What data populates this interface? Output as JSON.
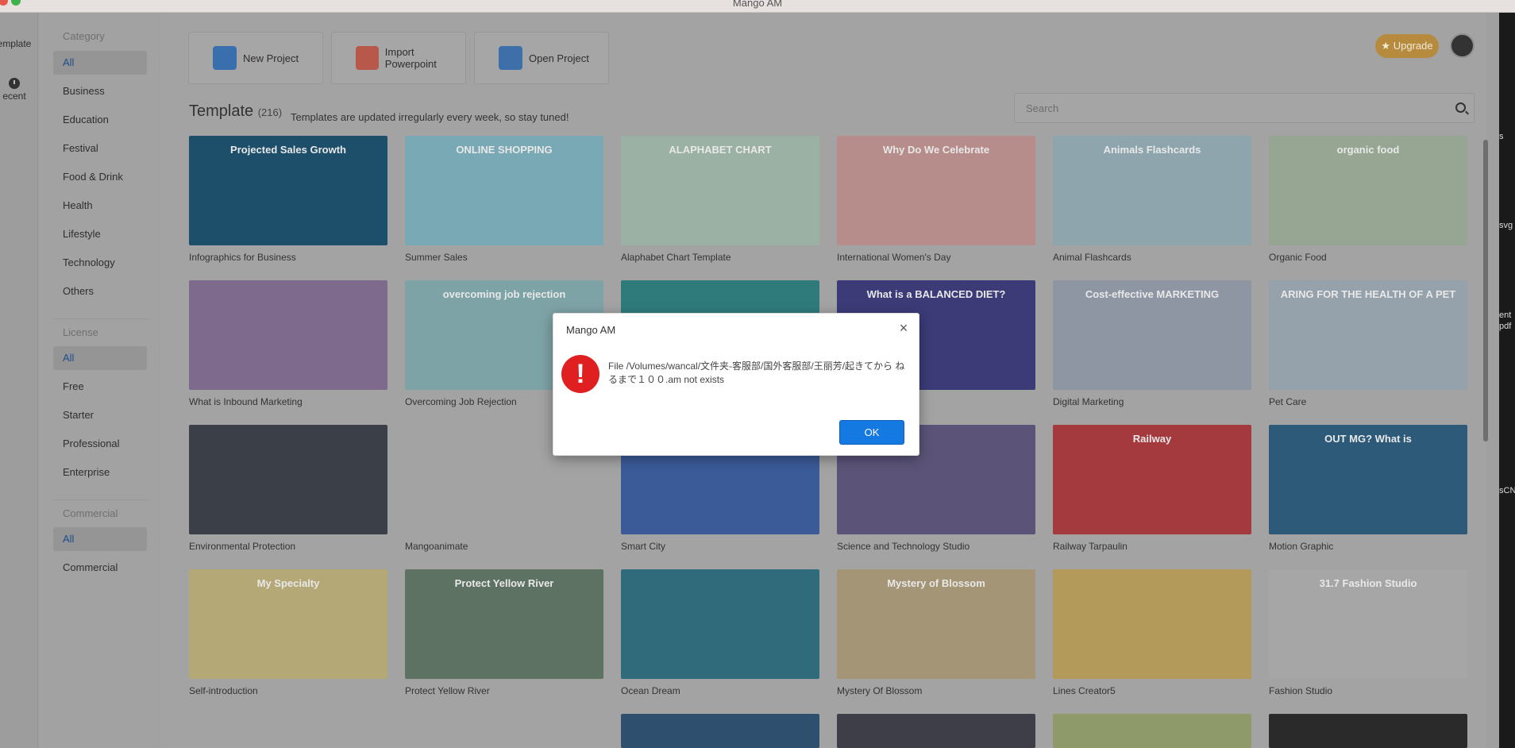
{
  "window": {
    "title": "Mango AM"
  },
  "rail": {
    "items": [
      {
        "label": "Template",
        "display": "emplate"
      },
      {
        "label": "Recent",
        "display": "ecent"
      }
    ]
  },
  "sidebar": {
    "category_heading": "Category",
    "categories": [
      "All",
      "Business",
      "Education",
      "Festival",
      "Food & Drink",
      "Health",
      "Lifestyle",
      "Technology",
      "Others"
    ],
    "license_heading": "License",
    "licenses": [
      "All",
      "Free",
      "Starter",
      "Professional",
      "Enterprise"
    ],
    "commercial_heading": "Commercial",
    "commercials": [
      "All",
      "Commercial"
    ]
  },
  "toolbar": {
    "new_project": "New Project",
    "import_ppt": "Import Powerpoint",
    "open_project": "Open Project",
    "upgrade": "Upgrade"
  },
  "section": {
    "title": "Template",
    "count": "(216)",
    "note": "Templates are updated irregularly every week, so stay tuned!"
  },
  "search": {
    "placeholder": "Search"
  },
  "templates": [
    {
      "caption": "Infographics for Business",
      "thumb_text": "Projected Sales Growth",
      "color": "#1d4e6a"
    },
    {
      "caption": "Summer Sales",
      "thumb_text": "ONLINE SHOPPING",
      "color": "#78a9b4"
    },
    {
      "caption": "Alaphabet Chart Template",
      "thumb_text": "ALAPHABET CHART",
      "color": "#9bb1a3"
    },
    {
      "caption": "International Women's Day",
      "thumb_text": "Why Do We Celebrate",
      "color": "#b78d8b"
    },
    {
      "caption": "Animal Flashcards",
      "thumb_text": "Animals Flashcards",
      "color": "#8fa5ae"
    },
    {
      "caption": "Organic Food",
      "thumb_text": "organic food",
      "color": "#97a692"
    },
    {
      "caption": "What is Inbound Marketing",
      "thumb_text": "",
      "color": "#7d6a8c"
    },
    {
      "caption": "Overcoming Job Rejection",
      "thumb_text": "overcoming job rejection",
      "color": "#7ea3a6"
    },
    {
      "caption": "",
      "thumb_text": "",
      "color": "#2f7b7b"
    },
    {
      "caption": "",
      "thumb_text": "What is a BALANCED DIET?",
      "color": "#3c3b78"
    },
    {
      "caption": "Digital Marketing",
      "thumb_text": "Cost-effective MARKETING",
      "color": "#8e96a3"
    },
    {
      "caption": "Pet Care",
      "thumb_text": "ARING FOR THE HEALTH OF A PET",
      "color": "#95a2ab"
    },
    {
      "caption": "Environmental Protection",
      "thumb_text": "",
      "color": "#3b3f47"
    },
    {
      "caption": "Mangoanimate",
      "thumb_text": "",
      "color": "#a3a3a3"
    },
    {
      "caption": "Smart City",
      "thumb_text": "How Smart City Works ?",
      "color": "#3b5b98"
    },
    {
      "caption": "Science and Technology Studio",
      "thumb_text": "",
      "color": "#5b5478"
    },
    {
      "caption": "Railway Tarpaulin",
      "thumb_text": "Railway",
      "color": "#a53a3e"
    },
    {
      "caption": "Motion Graphic",
      "thumb_text": "OUT MG? What is",
      "color": "#2e5a7a"
    },
    {
      "caption": "Self-introduction",
      "thumb_text": "My Specialty",
      "color": "#b4a877"
    },
    {
      "caption": "Protect Yellow River",
      "thumb_text": "Protect Yellow River",
      "color": "#5e7264"
    },
    {
      "caption": "Ocean Dream",
      "thumb_text": "",
      "color": "#2f6b7a"
    },
    {
      "caption": "Mystery Of Blossom",
      "thumb_text": "Mystery of Blossom",
      "color": "#a49576"
    },
    {
      "caption": "Lines Creator5",
      "thumb_text": "",
      "color": "#b39a5a"
    },
    {
      "caption": "Fashion Studio",
      "thumb_text": "31.7 Fashion Studio",
      "color": "#a6a6a6"
    }
  ],
  "dialog": {
    "title": "Mango AM",
    "message": "File /Volumes/wancal/文件夹-客服部/国外客服部/王丽芳/起きてから ねるまで１００.am not exists",
    "ok_label": "OK"
  },
  "edge_fragments": [
    "s",
    "svg",
    "ent",
    "pdf",
    "sCN"
  ]
}
